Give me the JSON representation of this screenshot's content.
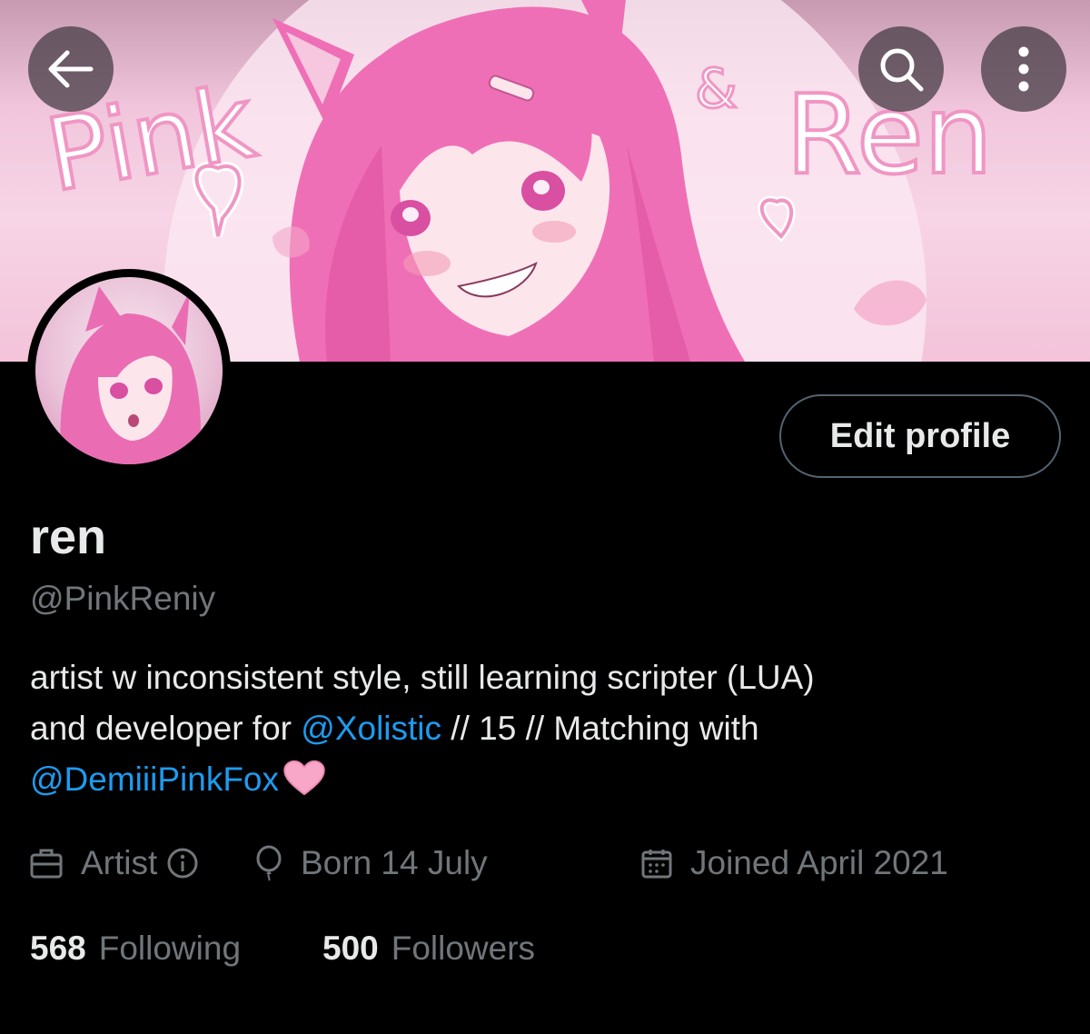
{
  "header": {
    "back_icon": "arrow-left-icon",
    "search_icon": "search-icon",
    "more_icon": "more-vertical-icon",
    "banner_text_left": "Pink",
    "banner_text_amp": "&",
    "banner_text_right": "Ren"
  },
  "profile": {
    "edit_button": "Edit profile",
    "display_name": "ren",
    "handle": "@PinkReniy"
  },
  "bio": {
    "line1": "artist w inconsistent style, still learning scripter (LUA)",
    "line2_prefix": "and developer for ",
    "mention1": "@Xolistic",
    "line2_suffix": " // 15 // Matching with",
    "mention2": "@DemiiiPinkFox",
    "heart_icon": "pink-heart-icon"
  },
  "meta": {
    "category": "Artist",
    "category_icon": "briefcase-icon",
    "info_icon": "info-icon",
    "birthday": "Born 14 July",
    "birthday_icon": "balloon-icon",
    "joined": "Joined April 2021",
    "joined_icon": "calendar-icon"
  },
  "stats": {
    "following_count": "568",
    "following_label": "Following",
    "followers_count": "500",
    "followers_label": "Followers"
  },
  "colors": {
    "background": "#000000",
    "text_primary": "#e7e9ea",
    "text_secondary": "#71767b",
    "link": "#1d9bf0",
    "button_border": "#536471",
    "banner_pink": "#f3c3da"
  }
}
